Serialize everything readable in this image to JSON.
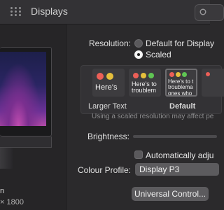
{
  "window": {
    "title": "Displays"
  },
  "display": {
    "size": "n",
    "resolution": "× 1800"
  },
  "resolution": {
    "label": "Resolution:",
    "options": [
      {
        "label": "Default for Display",
        "selected": false
      },
      {
        "label": "Scaled",
        "selected": true
      }
    ]
  },
  "scaled_options": {
    "thumbs": [
      {
        "text": "Here's",
        "caption": "Larger Text",
        "selected": false
      },
      {
        "text": "Here's to troublem",
        "caption": "",
        "selected": false
      },
      {
        "text": "Here's to t troublema ones who",
        "caption": "Default",
        "selected": true
      },
      {
        "text": "",
        "caption": "",
        "selected": false
      }
    ],
    "hint": "Using a scaled resolution may affect pe"
  },
  "brightness": {
    "label": "Brightness:"
  },
  "auto_adjust": {
    "label": "Automatically adju",
    "checked": false
  },
  "colour_profile": {
    "label": "Colour Profile:",
    "value": "Display P3"
  },
  "universal_control": {
    "label": "Universal Control..."
  },
  "colors": {
    "red": "#ec5f57",
    "yellow": "#e5bf3c",
    "green": "#5fc553"
  }
}
